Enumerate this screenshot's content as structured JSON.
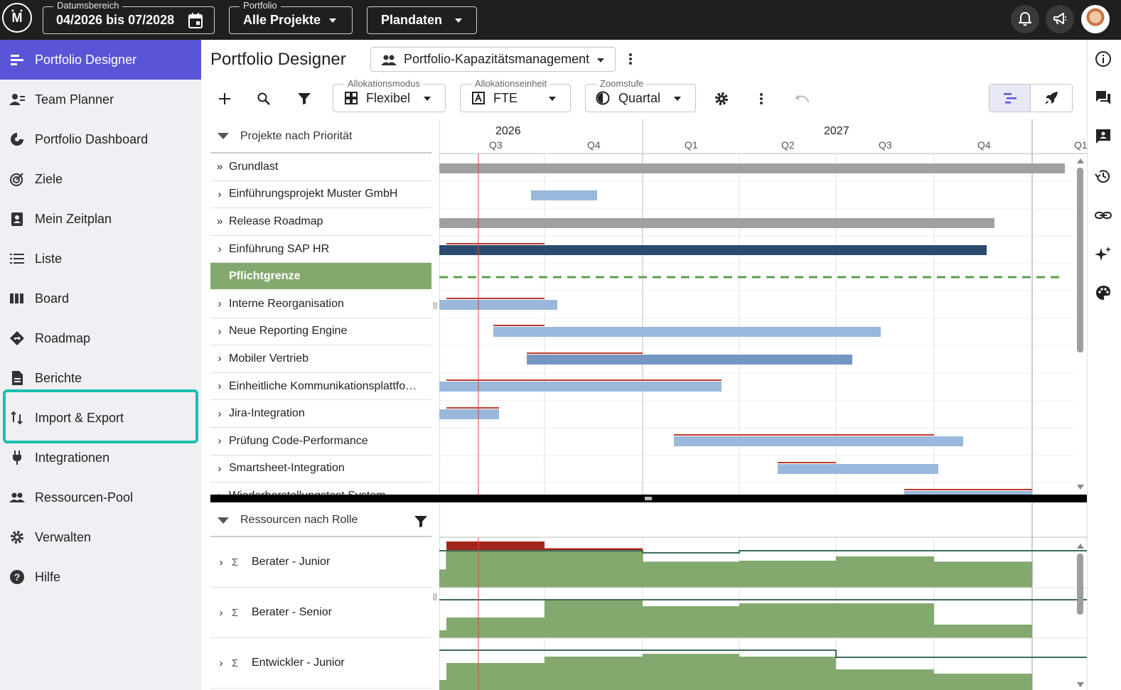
{
  "topbar": {
    "logo_text": "M",
    "date_range": {
      "legend": "Datumsbereich",
      "value": "04/2026 bis 07/2028"
    },
    "portfolio": {
      "legend": "Portfolio",
      "value": "Alle Projekte"
    },
    "plandaten": {
      "value": "Plandaten"
    }
  },
  "sidebar": {
    "items": [
      {
        "label": "Portfolio Designer",
        "icon": "gantt-icon"
      },
      {
        "label": "Team Planner",
        "icon": "team-icon"
      },
      {
        "label": "Portfolio Dashboard",
        "icon": "dashboard-icon"
      },
      {
        "label": "Ziele",
        "icon": "target-icon"
      },
      {
        "label": "Mein Zeitplan",
        "icon": "schedule-icon"
      },
      {
        "label": "Liste",
        "icon": "list-icon"
      },
      {
        "label": "Board",
        "icon": "board-icon"
      },
      {
        "label": "Roadmap",
        "icon": "roadmap-icon"
      },
      {
        "label": "Berichte",
        "icon": "report-icon"
      },
      {
        "label": "Import & Export",
        "icon": "import-export-icon"
      },
      {
        "label": "Integrationen",
        "icon": "plug-icon"
      },
      {
        "label": "Ressourcen-Pool",
        "icon": "people-icon"
      },
      {
        "label": "Verwalten",
        "icon": "gear-icon"
      },
      {
        "label": "Hilfe",
        "icon": "help-icon"
      }
    ]
  },
  "header": {
    "title": "Portfolio Designer",
    "view": "Portfolio-Kapazitätsmanagement"
  },
  "toolbar": {
    "allocation_mode": {
      "legend": "Allokationsmodus",
      "value": "Flexibel"
    },
    "allocation_unit": {
      "legend": "Allokationseinheit",
      "value": "FTE"
    },
    "zoom": {
      "legend": "Zoomstufe",
      "value": "Quartal"
    }
  },
  "gantt": {
    "group_label": "Projekte nach Priorität",
    "years": [
      "2026",
      "2027"
    ],
    "quarters": [
      "Q3",
      "Q4",
      "Q1",
      "Q2",
      "Q3",
      "Q4",
      "Q1"
    ],
    "rows": [
      {
        "label": "Grundlast",
        "chev": "»"
      },
      {
        "label": "Einführungsprojekt Muster GmbH",
        "chev": "›"
      },
      {
        "label": "Release Roadmap",
        "chev": "»"
      },
      {
        "label": "Einführung SAP HR",
        "chev": "›"
      },
      {
        "label": "Pflichtgrenze",
        "chev": ""
      },
      {
        "label": "Interne Reorganisation",
        "chev": "›"
      },
      {
        "label": "Neue Reporting Engine",
        "chev": "›"
      },
      {
        "label": "Mobiler Vertrieb",
        "chev": "›"
      },
      {
        "label": "Einheitliche Kommunikationsplattfo…",
        "chev": "›"
      },
      {
        "label": "Jira-Integration",
        "chev": "›"
      },
      {
        "label": "Prüfung Code-Performance",
        "chev": "›"
      },
      {
        "label": "Smartsheet-Integration",
        "chev": "›"
      },
      {
        "label": "Wiederherstellungstest System",
        "chev": "›"
      }
    ]
  },
  "resources": {
    "group_label": "Ressourcen nach Rolle",
    "rows": [
      {
        "label": "Berater - Junior"
      },
      {
        "label": "Berater - Senior"
      },
      {
        "label": "Entwickler - Junior"
      }
    ]
  },
  "colors": {
    "accent": "#5a55d6",
    "highlight": "#1cbfae",
    "bar_grey": "#a0a0a0",
    "bar_light_blue": "#99b8dc",
    "bar_mid_blue": "#7596c2",
    "bar_dark_blue": "#2c4a70",
    "overlay_red": "#c0392b",
    "capacity_green": "#84a96f"
  }
}
